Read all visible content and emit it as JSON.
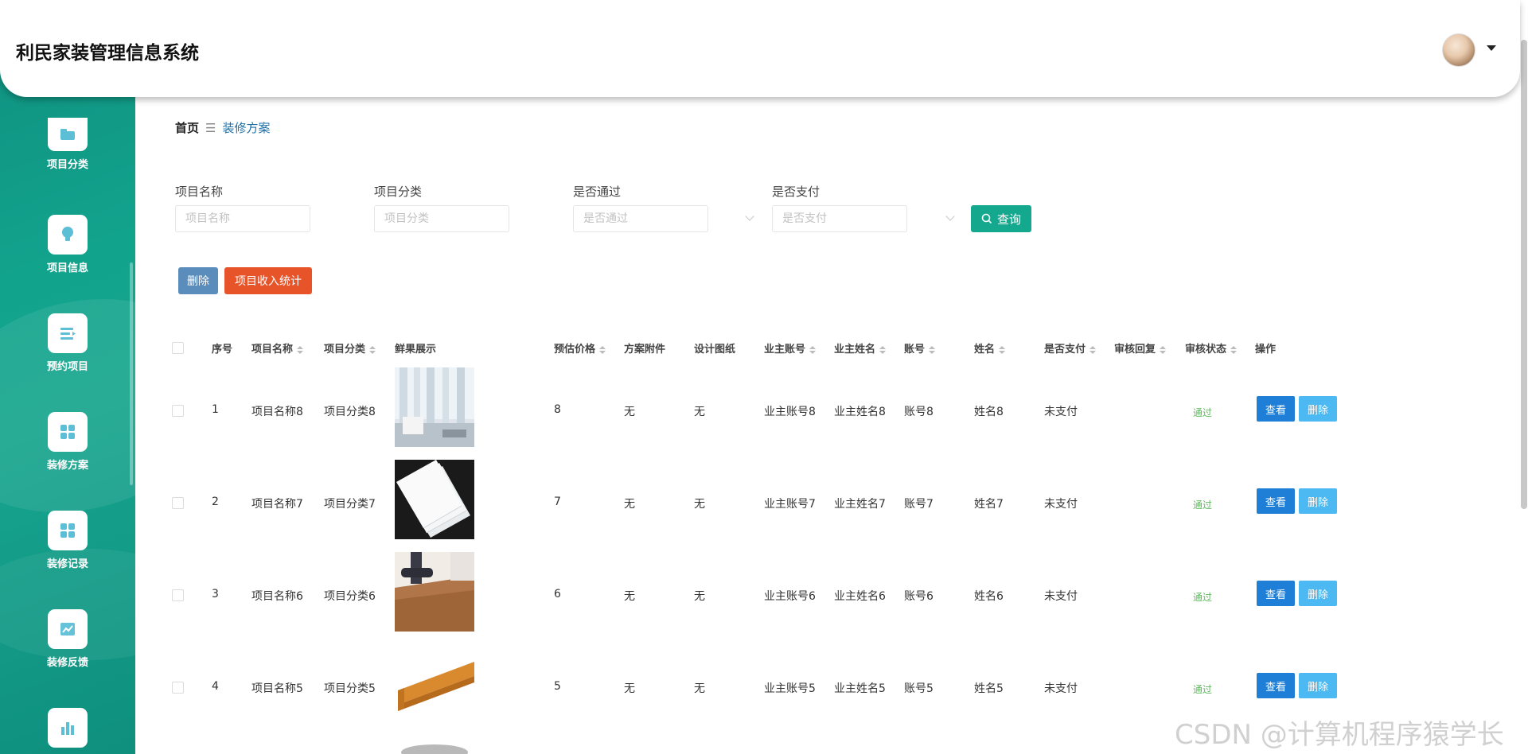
{
  "header": {
    "title": "利民家装管理信息系统"
  },
  "breadcrumb": {
    "home": "首页",
    "separator": "☰",
    "current": "装修方案"
  },
  "sidebar": {
    "items": [
      {
        "label": "项目分类",
        "icon": "folder-icon"
      },
      {
        "label": "项目信息",
        "icon": "lightbulb-icon"
      },
      {
        "label": "预约项目",
        "icon": "list-icon"
      },
      {
        "label": "装修方案",
        "icon": "grid-icon"
      },
      {
        "label": "装修记录",
        "icon": "grid-icon"
      },
      {
        "label": "装修反馈",
        "icon": "chart-icon"
      },
      {
        "label": "",
        "icon": "bar-chart-icon"
      }
    ]
  },
  "search": {
    "project_name_label": "项目名称",
    "project_name_placeholder": "项目名称",
    "category_label": "项目分类",
    "category_placeholder": "项目分类",
    "passed_label": "是否通过",
    "passed_placeholder": "是否通过",
    "paid_label": "是否支付",
    "paid_placeholder": "是否支付",
    "query_label": "查询"
  },
  "actions": {
    "delete_label": "删除",
    "stats_label": "项目收入统计"
  },
  "table": {
    "columns": [
      "序号",
      "项目名称",
      "项目分类",
      "鲜果展示",
      "预估价格",
      "方案附件",
      "设计图纸",
      "业主账号",
      "业主姓名",
      "账号",
      "姓名",
      "是否支付",
      "审核回复",
      "审核状态",
      "操作"
    ],
    "view_label": "查看",
    "delete_label": "删除",
    "rows": [
      {
        "no": "1",
        "name": "项目名称8",
        "category": "项目分类8",
        "price": "8",
        "attachment": "无",
        "drawing": "无",
        "owner_account": "业主账号8",
        "owner_name": "业主姓名8",
        "account": "账号8",
        "person": "姓名8",
        "paid": "未支付",
        "reply": "",
        "status": "通过"
      },
      {
        "no": "2",
        "name": "项目名称7",
        "category": "项目分类7",
        "price": "7",
        "attachment": "无",
        "drawing": "无",
        "owner_account": "业主账号7",
        "owner_name": "业主姓名7",
        "account": "账号7",
        "person": "姓名7",
        "paid": "未支付",
        "reply": "",
        "status": "通过"
      },
      {
        "no": "3",
        "name": "项目名称6",
        "category": "项目分类6",
        "price": "6",
        "attachment": "无",
        "drawing": "无",
        "owner_account": "业主账号6",
        "owner_name": "业主姓名6",
        "account": "账号6",
        "person": "姓名6",
        "paid": "未支付",
        "reply": "",
        "status": "通过"
      },
      {
        "no": "4",
        "name": "项目名称5",
        "category": "项目分类5",
        "price": "5",
        "attachment": "无",
        "drawing": "无",
        "owner_account": "业主账号5",
        "owner_name": "业主姓名5",
        "account": "账号5",
        "person": "姓名5",
        "paid": "未支付",
        "reply": "",
        "status": "通过"
      }
    ]
  },
  "watermark": "CSDN @计算机程序猿学长",
  "colors": {
    "sidebar": "#12a38d",
    "query": "#14a98f",
    "delete": "#5a8dbb",
    "stats": "#e8542a",
    "view": "#1f7fd6",
    "row_delete": "#4db9f2",
    "pass": "#5cb85c"
  }
}
